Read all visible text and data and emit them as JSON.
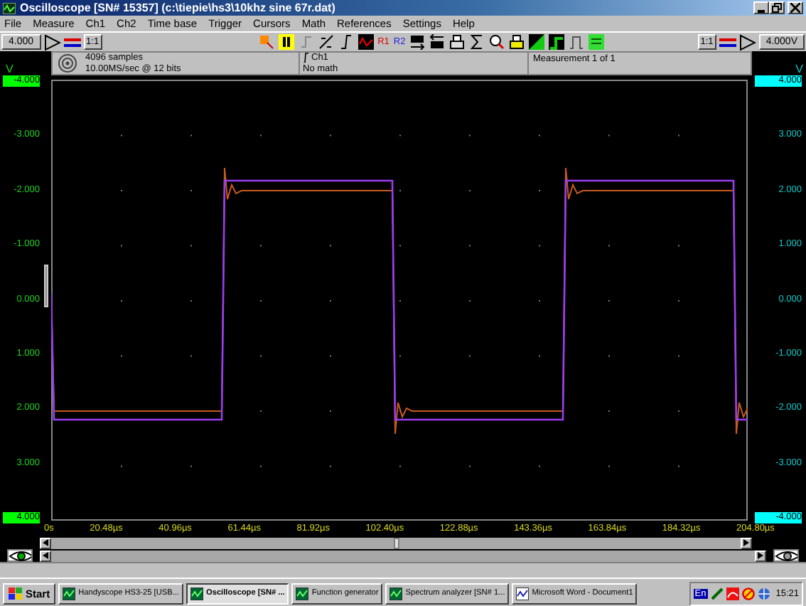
{
  "window": {
    "title": "Oscilloscope  [SN# 15357]  (c:\\tiepie\\hs3\\10khz sine 67r.dat)"
  },
  "menu": [
    "File",
    "Measure",
    "Ch1",
    "Ch2",
    "Time base",
    "Trigger",
    "Cursors",
    "Math",
    "References",
    "Settings",
    "Help"
  ],
  "toolbar": {
    "references": [
      "R1",
      "R2"
    ],
    "ch1_range": "4.000",
    "ch1_ratio": "1:1",
    "ch2_ratio": "1:1",
    "ch2_range": "4.000V"
  },
  "info": {
    "samples": "4096 samples",
    "rate": "10.00MS/sec @ 12 bits",
    "trigger_source": "Ch1",
    "math": "No math",
    "measurement": "Measurement 1 of 1"
  },
  "left_axis": {
    "unit": "V",
    "ticks": [
      "-4.000",
      "-3.000",
      "-2.000",
      "-1.000",
      "0.000",
      "1.000",
      "2.000",
      "3.000",
      "4.000"
    ]
  },
  "right_axis": {
    "unit": "V",
    "ticks": [
      "4.000",
      "3.000",
      "2.000",
      "1.000",
      "0.000",
      "-1.000",
      "-2.000",
      "-3.000",
      "-4.000"
    ]
  },
  "x_axis": {
    "ticks": [
      "0s",
      "20.48µs",
      "40.96µs",
      "61.44µs",
      "81.92µs",
      "102.40µs",
      "122.88µs",
      "143.36µs",
      "163.84µs",
      "184.32µs",
      "204.80µs"
    ]
  },
  "taskbar": {
    "start": "Start",
    "items": [
      {
        "label": "Handyscope HS3-25 [USB...",
        "selected": false
      },
      {
        "label": "Oscilloscope  [SN# ...",
        "selected": true
      },
      {
        "label": "Function generator",
        "selected": false
      },
      {
        "label": "Spectrum analyzer  [SN# 1...",
        "selected": false
      },
      {
        "label": "Microsoft Word - Document1",
        "selected": false
      }
    ],
    "language": "En",
    "clock": "15:21"
  }
}
